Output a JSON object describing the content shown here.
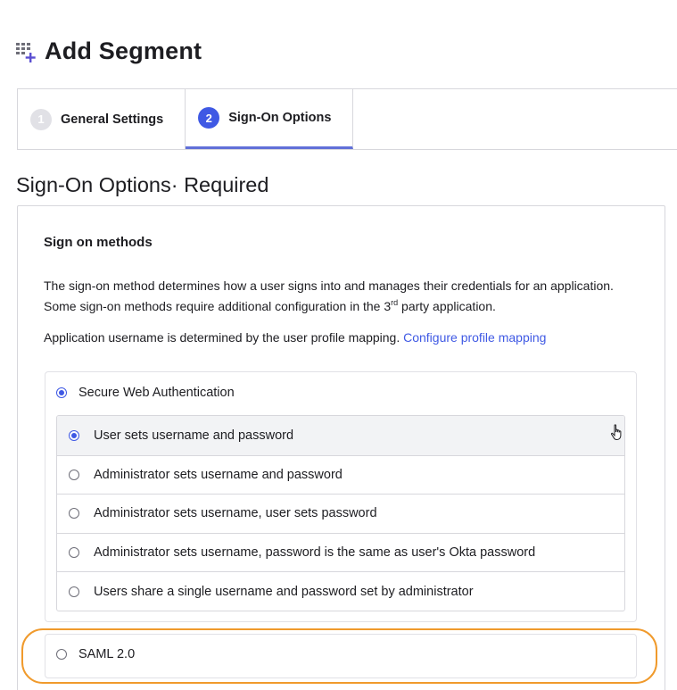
{
  "header": {
    "icon": "segment-add-icon",
    "title": "Add Segment"
  },
  "stepper": {
    "steps": [
      {
        "number": "1",
        "label": "General Settings",
        "state": "done"
      },
      {
        "number": "2",
        "label": "Sign-On Options",
        "state": "current"
      }
    ]
  },
  "section": {
    "title": "Sign-On Options· Required"
  },
  "methods": {
    "title": "Sign on methods",
    "description_1": "The sign-on method determines how a user signs into and manages their credentials for an application. Some sign-on methods require additional configuration in the 3",
    "description_sup": "rd",
    "description_2": " party application.",
    "mapping_text": "Application username is determined by the user profile mapping. ",
    "mapping_link": "Configure profile mapping"
  },
  "swa": {
    "label": "Secure Web Authentication",
    "selected": true,
    "options": [
      {
        "label": "User sets username and password",
        "selected": true
      },
      {
        "label": "Administrator sets username and password",
        "selected": false
      },
      {
        "label": "Administrator sets username, user sets password",
        "selected": false
      },
      {
        "label": "Administrator sets username, password is the same as user's Okta password",
        "selected": false
      },
      {
        "label": "Users share a single username and password set by administrator",
        "selected": false
      }
    ]
  },
  "saml": {
    "label": "SAML 2.0",
    "selected": false
  },
  "colors": {
    "accent": "#3f59e4",
    "highlight": "#f09a2c",
    "tab_underline": "#6170d8"
  }
}
